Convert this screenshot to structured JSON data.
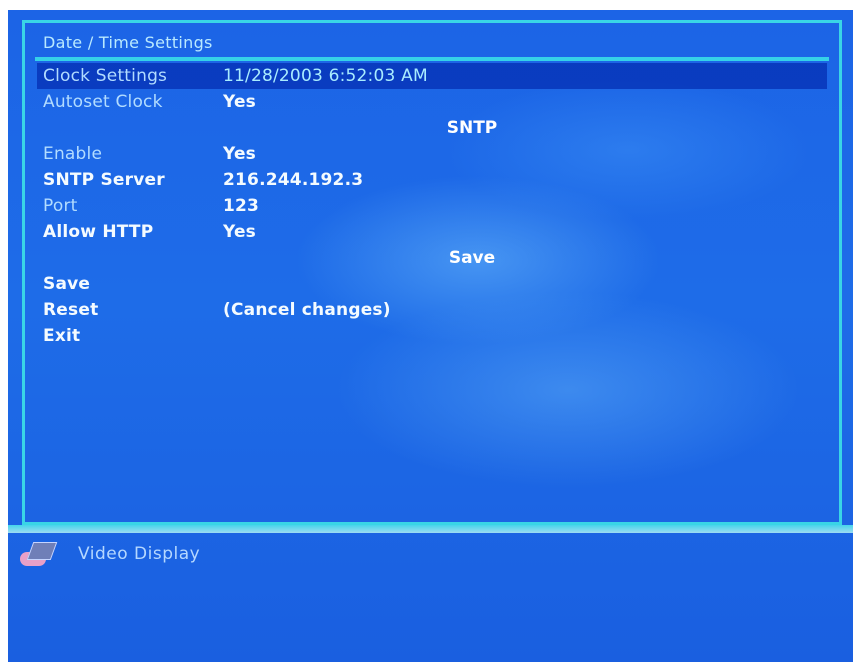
{
  "dialog": {
    "title": "Date / Time Settings"
  },
  "rows": {
    "clock_settings": {
      "label": "Clock Settings",
      "value": "11/28/2003 6:52:03 AM"
    },
    "autoset_clock": {
      "label": "Autoset Clock",
      "value": "Yes"
    },
    "sntp_header": "SNTP",
    "enable": {
      "label": "Enable",
      "value": "Yes"
    },
    "sntp_server": {
      "label": "SNTP Server",
      "value": "216.244.192.3"
    },
    "port": {
      "label": "Port",
      "value": "123"
    },
    "allow_http": {
      "label": "Allow HTTP",
      "value": "Yes"
    },
    "save_header": "Save",
    "save": {
      "label": "Save"
    },
    "reset": {
      "label": "Reset",
      "value": "(Cancel changes)"
    },
    "exit": {
      "label": "Exit"
    }
  },
  "taskbar": {
    "item_label": "Video Display",
    "item_icon": "display-icon"
  },
  "colors": {
    "background": "#1e6ce8",
    "border": "#39d5e6",
    "selected": "#0026aa"
  }
}
